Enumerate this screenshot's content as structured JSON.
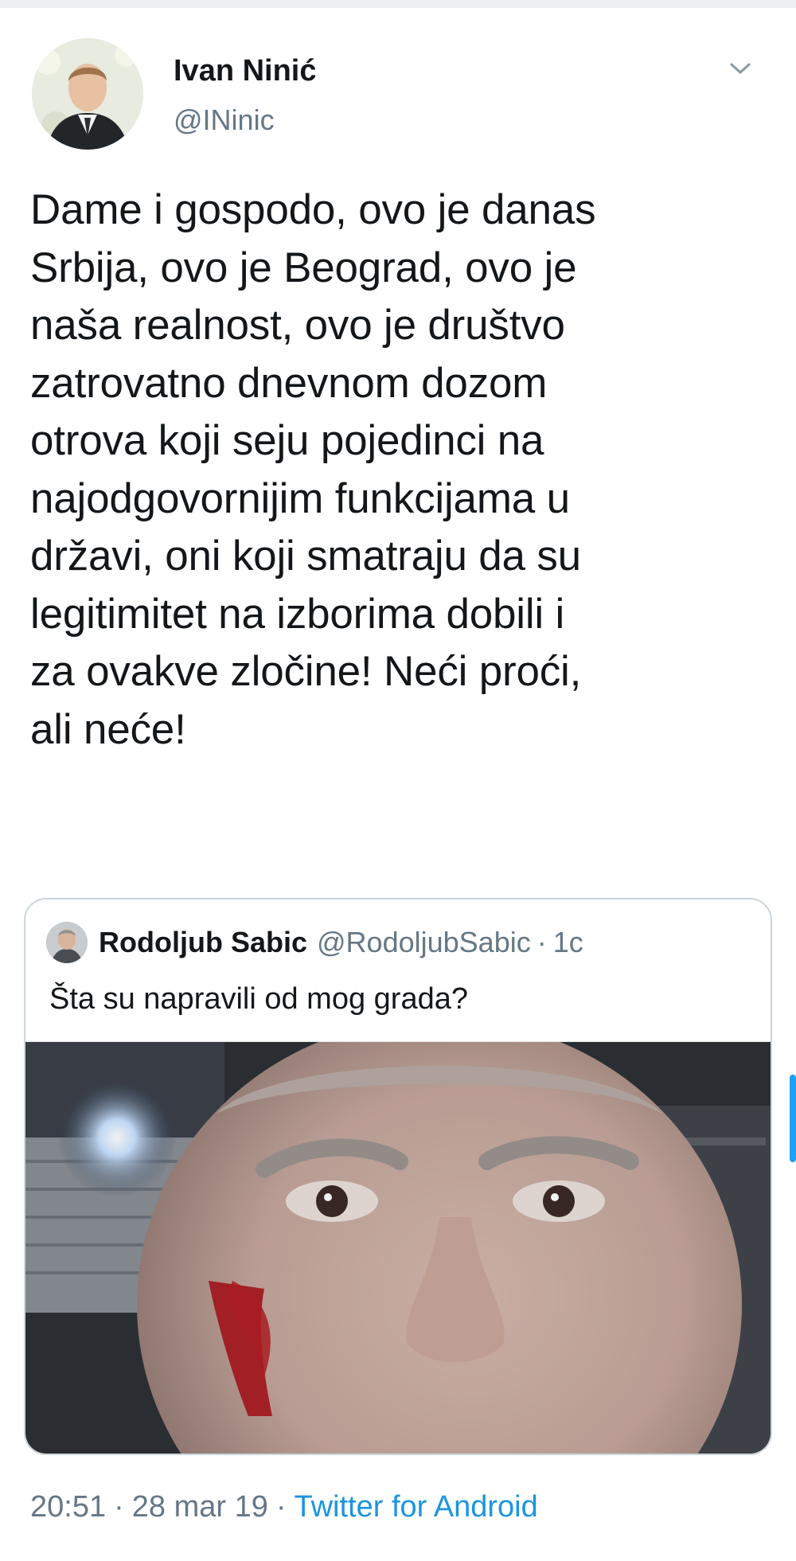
{
  "tweet": {
    "author_name": "Ivan Ninić",
    "author_handle": "@INinic",
    "avatar_icon": "user-avatar-photo",
    "menu_icon": "chevron-down-icon",
    "text": "Dame i gospodo, ovo je danas\nSrbija, ovo je Beograd, ovo je\nnaša realnost, ovo je društvo\nzatrovatno dnevnom dozom\notrova koji seju pojedinci na\nnajodgovornijim funkcijama u\ndržavi, oni koji smatraju da su\nlegitimitet na izborima dobili i\nza ovakve zločine! Neći proći,\nali neće!",
    "time": "20:51",
    "date": "28 mar 19",
    "source": "Twitter for Android",
    "separator": "·"
  },
  "quoted_tweet": {
    "author_name": "Rodoljub Sabic",
    "author_handle": "@RodoljubSabic",
    "separator": "·",
    "age": "1c",
    "text": "Šta su napravili od mog grada?",
    "photo_icon": "selfie-photo-injured-face"
  },
  "colors": {
    "text_primary": "#14171a",
    "text_secondary": "#657786",
    "link": "#1b95e0",
    "border": "#ccd6dd"
  }
}
